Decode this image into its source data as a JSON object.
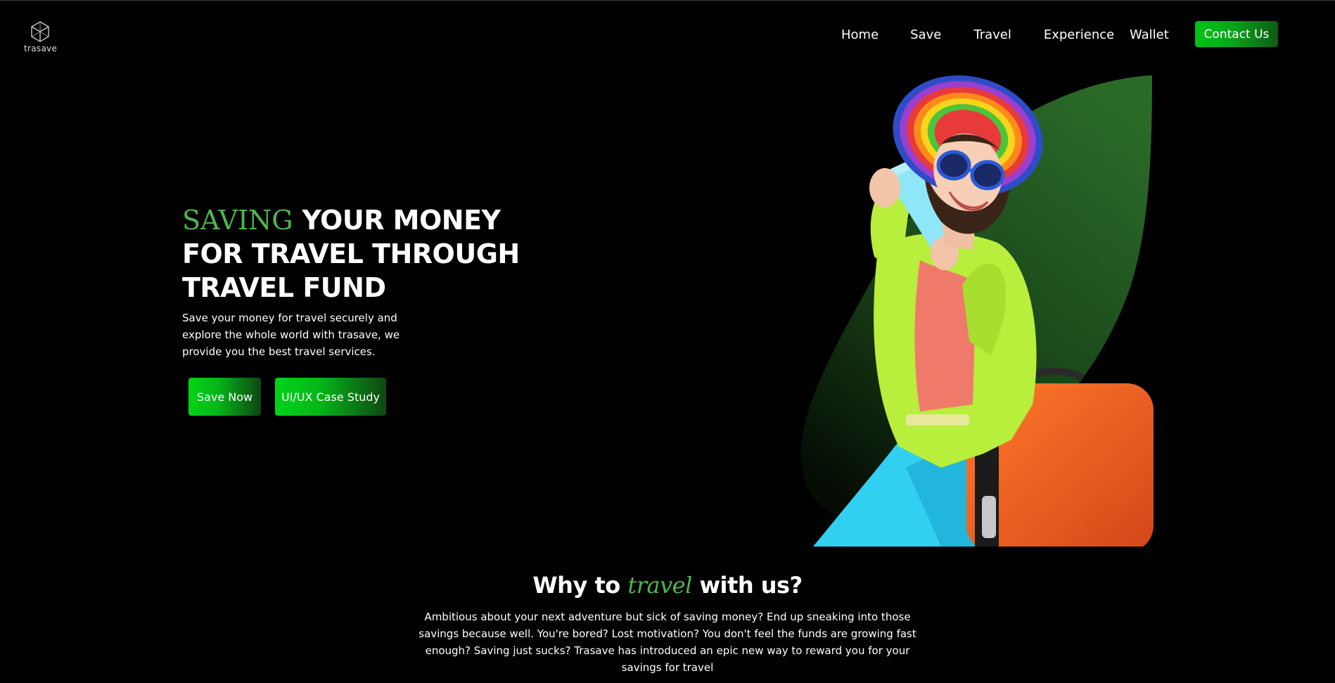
{
  "brand": {
    "name": "trasave",
    "logo_icon": "cube-logo-icon"
  },
  "nav": {
    "items": [
      "Home",
      "Save",
      "Travel",
      "Experience",
      "Wallet"
    ],
    "contact_label": "Contact Us"
  },
  "hero": {
    "title_accent": "SAVING",
    "title_rest": " YOUR MONEY FOR TRAVEL THROUGH TRAVEL FUND",
    "description": "Save your money for travel securely and explore the whole world with trasave, we provide you the best travel services.",
    "primary_button": "Save Now",
    "secondary_button": "UI/UX Case Study",
    "image": "woman-with-hat-and-orange-suitcase"
  },
  "why": {
    "title_before": "Why to ",
    "title_accent": "travel",
    "title_after": " with us?",
    "description": "Ambitious about your next adventure but sick of saving money? End up sneaking into those savings because well. You're bored? Lost motivation? You don't feel the funds are growing fast enough? Saving just sucks? Trasave has introduced an epic new way to reward you for your savings for travel"
  },
  "colors": {
    "background": "#000000",
    "accent_green": "#4cb84c",
    "button_green": "#00c414",
    "leaf_green": "#1f5a1f"
  }
}
